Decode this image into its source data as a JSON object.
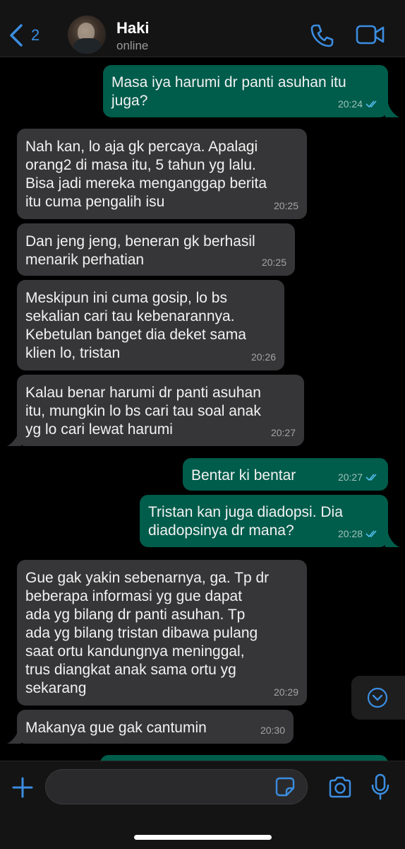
{
  "header": {
    "back_count": "2",
    "contact_name": "Haki",
    "contact_status": "online"
  },
  "messages": [
    {
      "direction": "out",
      "text": "Masa iya harumi dr panti asuhan itu\njuga?",
      "time": "20:24",
      "read": true
    },
    {
      "direction": "in",
      "text": "Nah kan, lo aja gk percaya. Apalagi\norang2 di masa itu, 5 tahun yg lalu.\nBisa jadi mereka menganggap berita\nitu cuma pengalih isu",
      "time": "20:25"
    },
    {
      "direction": "in",
      "text": "Dan jeng jeng, beneran gk berhasil\nmenarik perhatian",
      "time": "20:25"
    },
    {
      "direction": "in",
      "text": "Meskipun ini cuma gosip, lo bs\nsekalian cari tau kebenarannya.\nKebetulan banget dia deket sama\nklien lo, tristan",
      "time": "20:26"
    },
    {
      "direction": "in",
      "text": "Kalau benar harumi dr panti asuhan\nitu, mungkin lo bs cari tau soal anak\nyg lo cari lewat harumi",
      "time": "20:27"
    },
    {
      "direction": "out",
      "text": "Bentar ki bentar",
      "time": "20:27",
      "read": true
    },
    {
      "direction": "out",
      "text": "Tristan kan juga diadopsi. Dia\ndiadopsinya dr mana?",
      "time": "20:28",
      "read": true
    },
    {
      "direction": "in",
      "text": "Gue gak yakin sebenarnya, ga. Tp dr\nbeberapa informasi yg gue dapat\nada yg bilang dr panti asuhan. Tp\nada yg bilang tristan dibawa pulang\nsaat ortu kandungnya meninggal,\ntrus diangkat anak sama ortu yg\nsekarang",
      "time": "20:29"
    },
    {
      "direction": "in",
      "text": "Makanya gue gak cantumin",
      "time": "20:30"
    }
  ],
  "colors": {
    "accent": "#3b8de0",
    "incoming_bubble": "#363638",
    "outgoing_bubble": "#005c4b",
    "background": "#000000"
  },
  "icons": {
    "back": "chevron-left-icon",
    "call": "phone-icon",
    "video": "video-camera-icon",
    "scroll": "chevron-down-circle-icon",
    "attach": "plus-icon",
    "sticker": "sticker-icon",
    "camera": "camera-icon",
    "mic": "microphone-icon"
  }
}
